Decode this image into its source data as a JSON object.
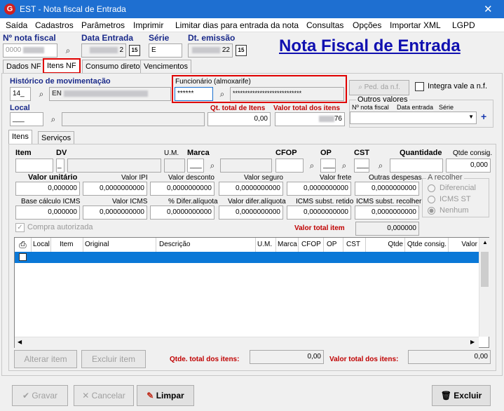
{
  "window": {
    "title": "EST - Nota fiscal de Entrada",
    "close": "✕"
  },
  "menu": [
    "Saída",
    "Cadastros",
    "Parâmetros",
    "Imprimir",
    "Limitar dias para entrada da nota",
    "Consultas",
    "Opções",
    "Importar XML",
    "LGPD"
  ],
  "header": {
    "nota_label": "Nº nota fiscal",
    "nota_value": "0000",
    "data_entrada_label": "Data Entrada",
    "data_entrada_value": "2",
    "serie_label": "Série",
    "serie_value": "E",
    "dt_emissao_label": "Dt. emissão",
    "dt_emissao_value": "22",
    "calendar_btn": "15",
    "big_title": "Nota Fiscal de Entrada"
  },
  "tabs": [
    "Dados NF",
    "Itens NF",
    "Consumo direto",
    "Vencimentos"
  ],
  "movimentacao": {
    "label": "Histórico de movimentação",
    "code": "14_",
    "desc": "EN",
    "funcionario_label": "Funcionário (almoxarife)",
    "funcionario_code": "******",
    "funcionario_name": "****************************",
    "ped_btn": "Ped. da n.f.",
    "integra_label": "Integra vale a n.f.",
    "local_label": "Local",
    "local_value": "___",
    "qt_total_label": "Qt. total de Itens",
    "qt_total_value": "0,00",
    "valor_total_label": "Valor total dos itens",
    "valor_total_value": "76",
    "outros_title": "Outros valores",
    "outros_cols": [
      "Nº nota fiscal",
      "Data entrada",
      "Série"
    ],
    "plus": "+"
  },
  "subtabs": [
    "Itens",
    "Serviços"
  ],
  "item_fields": {
    "item": "Item",
    "dv": "DV",
    "dv_value": "_",
    "um": "U.M.",
    "marca": "Marca",
    "marca_value": "___",
    "cfop": "CFOP",
    "op": "OP",
    "op_value": "___",
    "cst": "CST",
    "cst_value": "___",
    "quantidade": "Quantidade",
    "qtde_consig": "Qtde consig.",
    "qtde_consig_value": "0,000",
    "valor_unitario": "Valor unitário",
    "valor_unitario_value": "0,000000",
    "valor_ipi": "Valor IPI",
    "valor_ipi_value": "0,0000000000",
    "valor_desconto": "Valor desconto",
    "valor_desconto_value": "0,0000000000",
    "valor_seguro": "Valor seguro",
    "valor_seguro_value": "0,0000000000",
    "valor_frete": "Valor frete",
    "valor_frete_value": "0,0000000000",
    "outras_despesas": "Outras despesas",
    "outras_despesas_value": "0,0000000000",
    "base_calc_icms": "Base cálculo ICMS",
    "base_calc_icms_value": "0,000000",
    "valor_icms": "Valor ICMS",
    "valor_icms_value": "0,0000000000",
    "difer_aliquota_pct": "% Difer.alíquota",
    "difer_aliquota_pct_value": "0,0000000000",
    "valor_difer_aliquota": "Valor difer.alíquota",
    "valor_difer_aliquota_value": "0,0000000000",
    "icms_subst_retido": "ICMS subst. retido",
    "icms_subst_retido_value": "0,0000000000",
    "icms_subst_recolher": "ICMS subst. recolher",
    "icms_subst_recolher_value": "0,0000000000",
    "a_recolher_title": "A recolher",
    "a_recolher_options": [
      "Diferencial",
      "ICMS ST",
      "Nenhum"
    ],
    "compra_autorizada": "Compra autorizada",
    "valor_total_item_label": "Valor total item",
    "valor_total_item_value": "0,000000"
  },
  "grid": {
    "columns": [
      "Local",
      "Item",
      "Original",
      "Descrição",
      "U.M.",
      "Marca",
      "CFOP",
      "OP",
      "CST",
      "Qtde",
      "Qtde consig.",
      "Valor"
    ]
  },
  "bottom": {
    "alterar": "Alterar item",
    "excluir_item": "Excluir item",
    "qtde_total_label": "Qtde. total dos itens:",
    "qtde_total_value": "0,00",
    "valor_total_label": "Valor total dos itens:",
    "valor_total_value": "0,00"
  },
  "footer": {
    "gravar": "Gravar",
    "cancelar": "Cancelar",
    "limpar": "Limpar",
    "excluir": "Excluir"
  }
}
